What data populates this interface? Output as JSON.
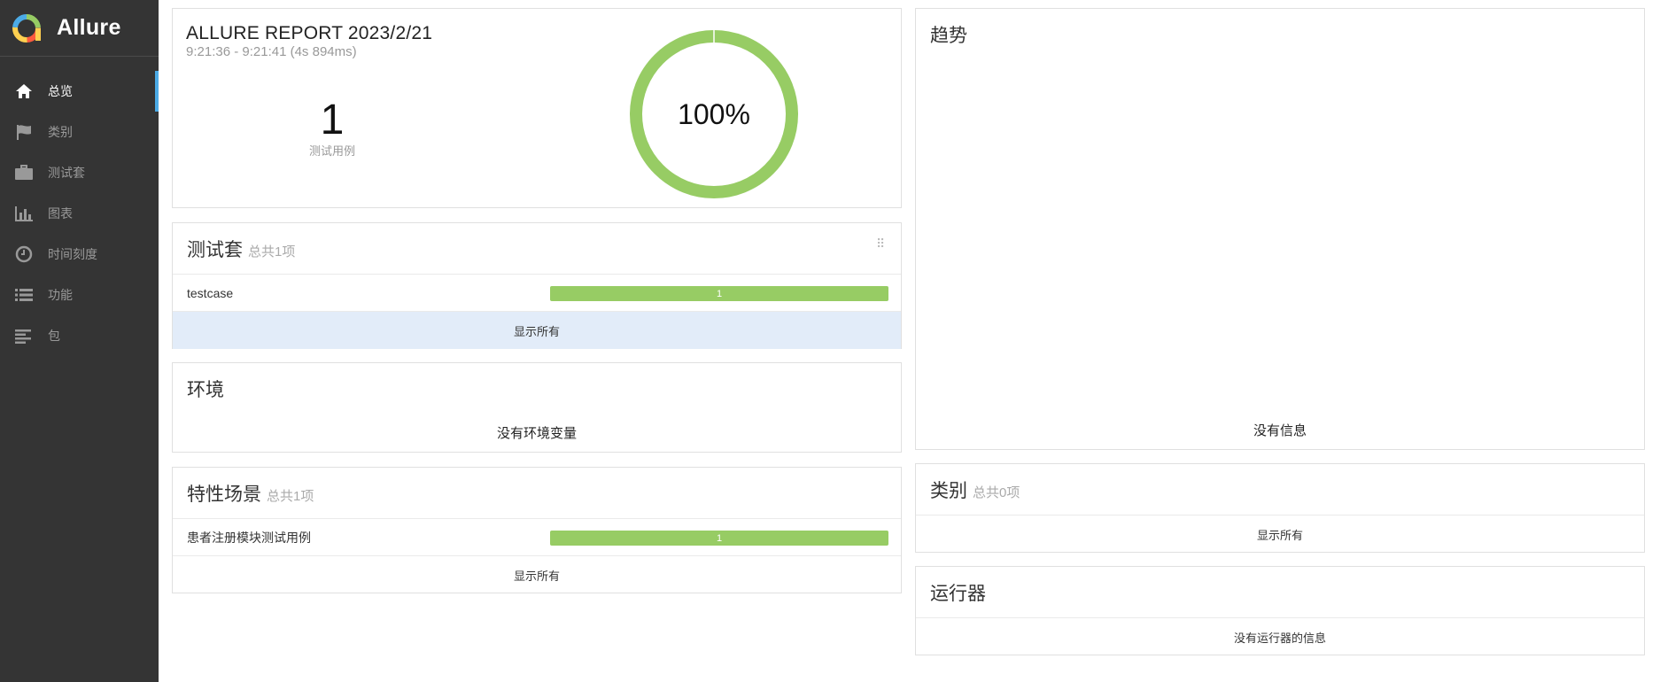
{
  "brand": {
    "name": "Allure"
  },
  "nav": [
    {
      "label": "总览",
      "icon": "home-icon",
      "active": true
    },
    {
      "label": "类别",
      "icon": "flag-icon"
    },
    {
      "label": "测试套",
      "icon": "briefcase-icon"
    },
    {
      "label": "图表",
      "icon": "bar-chart-icon"
    },
    {
      "label": "时间刻度",
      "icon": "clock-icon"
    },
    {
      "label": "功能",
      "icon": "list-icon"
    },
    {
      "label": "包",
      "icon": "align-left-icon"
    }
  ],
  "summary": {
    "title": "ALLURE REPORT 2023/2/21",
    "time_range": "9:21:36 - 9:21:41 (4s 894ms)",
    "total": "1",
    "total_label": "测试用例",
    "pass_rate": "100%",
    "pass_fraction": 1.0,
    "color": "#97cc64"
  },
  "suites": {
    "title": "测试套",
    "count": "总共1项",
    "items": [
      {
        "name": "testcase",
        "value": "1"
      }
    ],
    "show_all": "显示所有"
  },
  "environment": {
    "title": "环境",
    "empty": "没有环境变量"
  },
  "features": {
    "title": "特性场景",
    "count": "总共1项",
    "items": [
      {
        "name": "患者注册模块测试用例",
        "value": "1"
      }
    ],
    "show_all": "显示所有"
  },
  "trend": {
    "title": "趋势",
    "empty": "没有信息"
  },
  "categories": {
    "title": "类别",
    "count": "总共0项",
    "show_all": "显示所有"
  },
  "executors": {
    "title": "运行器",
    "empty": "没有运行器的信息"
  }
}
